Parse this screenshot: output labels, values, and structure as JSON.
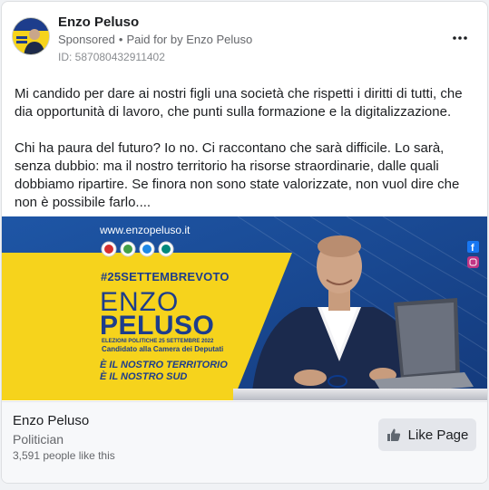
{
  "post": {
    "page_name": "Enzo Peluso",
    "sponsored_label": "Sponsored",
    "paid_for_label": "Paid for by Enzo Peluso",
    "ad_id": "ID: 587080432911402",
    "paragraph_1": "Mi candido per dare ai nostri figli una società che rispetti i diritti di tutti, che dia opportunità di lavoro, che punti sulla formazione e la digitalizzazione.",
    "paragraph_2": "Chi ha paura del futuro? Io no. Ci raccontano che sarà difficile. Lo sarà, senza dubbio: ma il nostro territorio ha risorse straordinarie, dalle quali dobbiamo ripartire. Se finora non sono state valorizzate, non vuol dire che non è possibile farlo...."
  },
  "creative": {
    "url": "www.enzopeluso.it",
    "hashtag": "#25SETTEMBREVOTO",
    "first_name": "ENZO",
    "last_name": "PELUSO",
    "election_line": "ELEZIONI POLITICHE 25 SETTEMBRE 2022",
    "candidate_line": "Candidato alla Camera dei Deputati",
    "slogan_1": "È IL NOSTRO TERRITORIO",
    "slogan_2": "È IL NOSTRO SUD",
    "colors": {
      "navy": "#1d3d8c",
      "yellow": "#f6d31c",
      "bg": "#1a4a91"
    }
  },
  "footer": {
    "page_name": "Enzo Peluso",
    "category": "Politician",
    "likes": "3,591 people like this",
    "like_button_label": "Like Page"
  },
  "icons": [
    "more-icon",
    "thumbs-up-icon",
    "facebook-icon",
    "instagram-icon"
  ]
}
